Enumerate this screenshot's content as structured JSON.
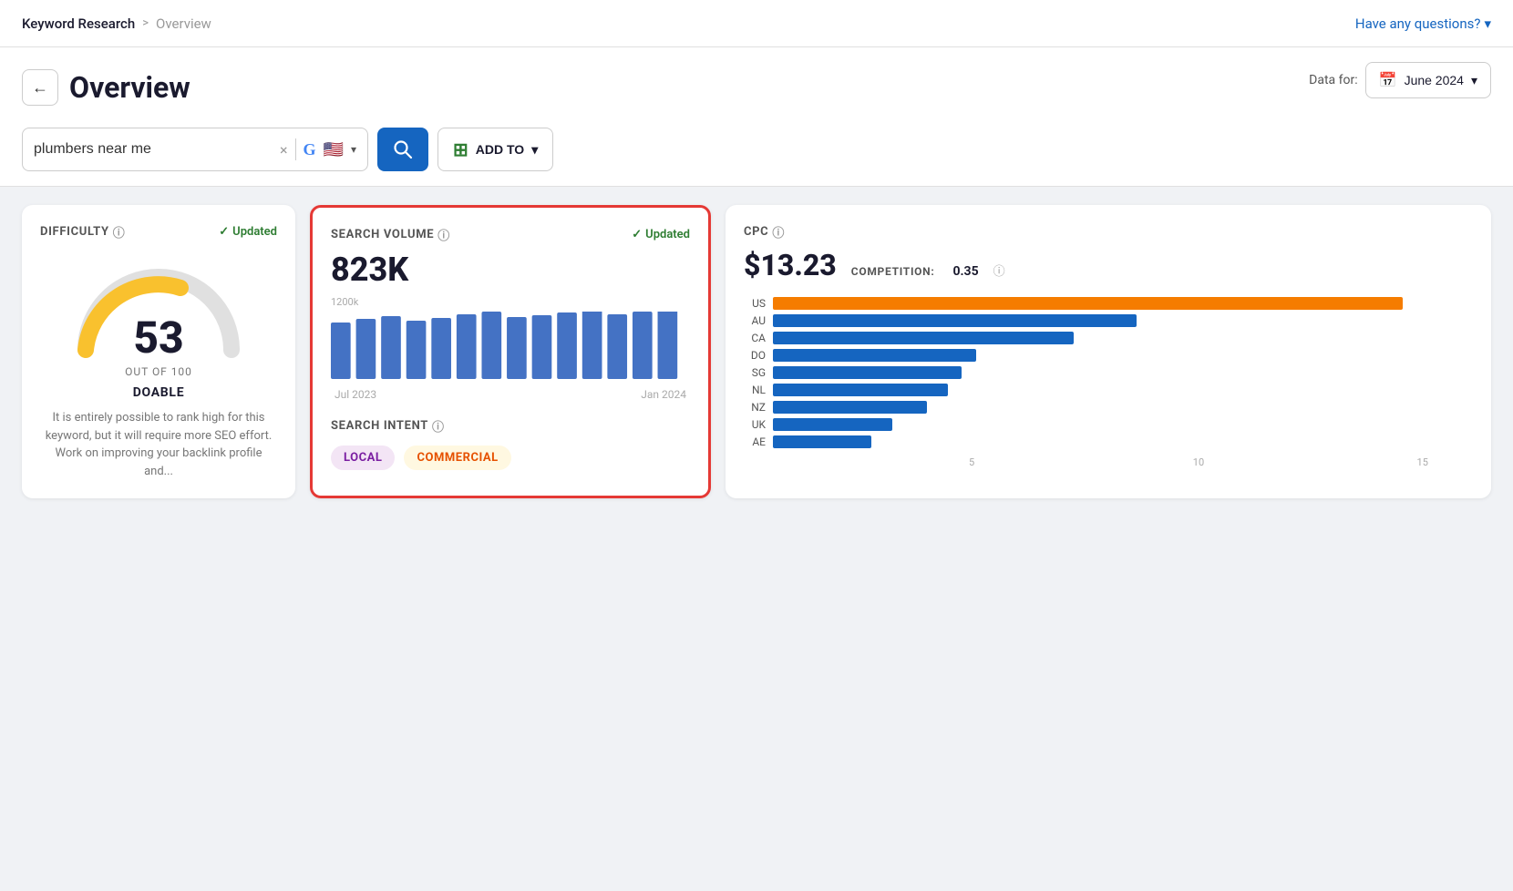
{
  "nav": {
    "breadcrumb_root": "Keyword Research",
    "breadcrumb_sep": ">",
    "breadcrumb_current": "Overview",
    "help_text": "Have any questions?",
    "help_arrow": "▾"
  },
  "header": {
    "back_label": "←",
    "title": "Overview",
    "search_value": "plumbers near me",
    "clear_label": "×",
    "google_icon": "G",
    "flag": "🇺🇸",
    "search_icon": "🔍",
    "add_to_label": "ADD TO",
    "add_arrow": "▾",
    "data_for_label": "Data for:",
    "cal_icon": "📅",
    "date_label": "June 2024",
    "date_arrow": "▾"
  },
  "difficulty": {
    "label": "DIFFICULTY",
    "updated_label": "Updated",
    "value": "53",
    "out_of": "OUT OF 100",
    "rating": "DOABLE",
    "description": "It is entirely possible to rank high for this keyword, but it will require more SEO effort. Work on improving your backlink profile and..."
  },
  "search_volume": {
    "label": "SEARCH VOLUME",
    "updated_label": "Updated",
    "value": "823K",
    "chart_max_label": "1200k",
    "x_label_left": "Jul 2023",
    "x_label_right": "Jan 2024",
    "bars": [
      68,
      72,
      75,
      70,
      73,
      78,
      80,
      74,
      76,
      79,
      82,
      77,
      80,
      83
    ]
  },
  "cpc": {
    "label": "CPC",
    "value": "$13.23",
    "competition_label": "COMPETITION:",
    "competition_value": "0.35",
    "countries": [
      "US",
      "AU",
      "CA",
      "DO",
      "SG",
      "NL",
      "NZ",
      "UK",
      "AE"
    ],
    "bars": [
      100,
      58,
      48,
      32,
      30,
      28,
      24,
      18,
      15
    ],
    "colors": [
      "orange",
      "blue",
      "blue",
      "blue",
      "blue",
      "blue",
      "blue",
      "blue",
      "blue"
    ],
    "axis_labels": [
      "5",
      "10",
      "15"
    ]
  },
  "search_intent": {
    "label": "SEARCH INTENT",
    "badges": [
      "LOCAL",
      "COMMERCIAL"
    ]
  }
}
